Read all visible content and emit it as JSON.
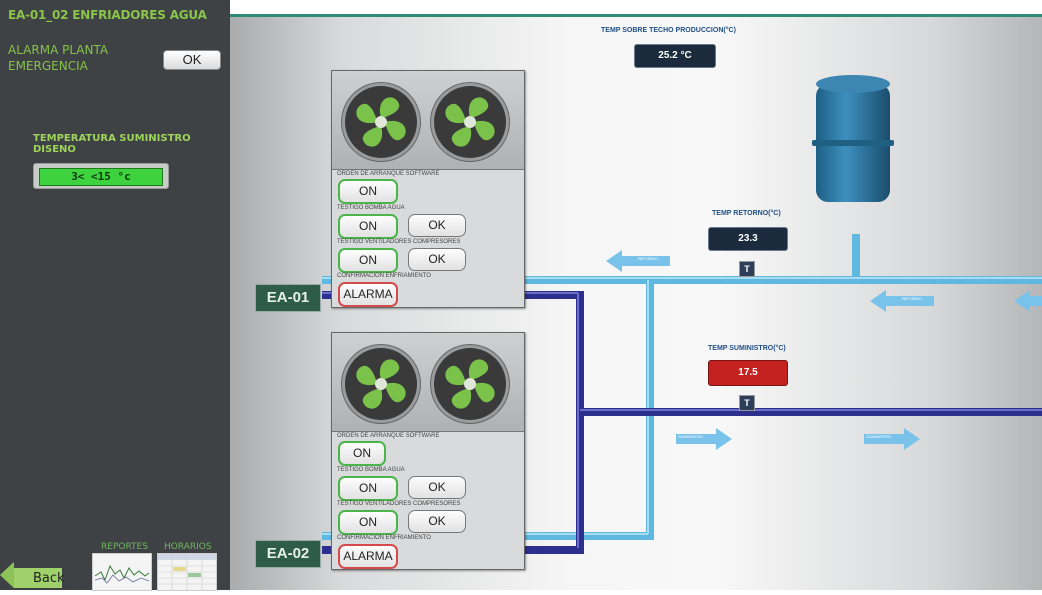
{
  "sidebar": {
    "title": "EA-01_02 ENFRIADORES AGUA",
    "alarm_label": "ALARMA PLANTA EMERGENCIA",
    "alarm_button": "OK",
    "temp_label": "TEMPERATURA SUMINISTRO DISENO",
    "temp_value": "3< <15 °c",
    "reports_label": "REPORTES",
    "schedules_label": "HORARIOS",
    "back_label": "Back"
  },
  "displays": {
    "roof_label": "TEMP SOBRE TECHO PRODUCCION(°C)",
    "roof_value": "25.2 °C",
    "return_label": "TEMP RETORNO(°C)",
    "return_value": "23.3",
    "supply_label": "TEMP SUMINISTRO(°C)",
    "supply_value": "17.5",
    "sensor_symbol": "T"
  },
  "flow_labels": {
    "return": "RETORNO",
    "supply": "SUMINISTRO"
  },
  "chillers": [
    {
      "tag": "EA-01",
      "start_order_label": "ORDEN DE ARRANQUE SOFTWARE",
      "start_order_value": "ON",
      "pump_label": "TESTIGO BOMBA AGUA",
      "pump_on": "ON",
      "pump_ok": "OK",
      "fans_label": "TESTIGO VENTILADORES COMPRESORES",
      "fans_on": "ON",
      "fans_ok": "OK",
      "confirm_label": "CONFIRMACION ENFRIAMIENTO",
      "confirm_value": "ALARMA"
    },
    {
      "tag": "EA-02",
      "start_order_label": "ORDEN DE ARRANQUE SOFTWARE",
      "start_order_value": "ON",
      "pump_label": "TESTIGO BOMBA AGUA",
      "pump_on": "ON",
      "pump_ok": "OK",
      "fans_label": "TESTIGO VENTILADORES COMPRESORES",
      "fans_on": "ON",
      "fans_ok": "OK",
      "confirm_label": "CONFIRMACION ENFRIAMIENTO",
      "confirm_value": "ALARMA"
    }
  ],
  "colors": {
    "sidebar_bg": "#3f4244",
    "sidebar_text": "#8ac54a",
    "return_pipe": "#6ec3e6",
    "supply_pipe": "#2b2f8f",
    "alarm_red": "#d54b4b",
    "ok_green": "#4ab54a",
    "supply_display": "#c42121",
    "display_dark": "#1c2a3b"
  }
}
